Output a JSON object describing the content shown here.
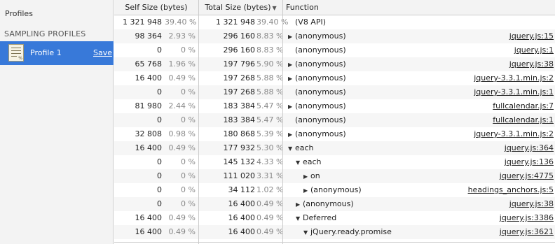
{
  "sidebar": {
    "title": "Profiles",
    "section": "SAMPLING PROFILES",
    "profile": {
      "label": "Profile 1",
      "save": "Save",
      "icon_text": "%"
    }
  },
  "columns": {
    "self": "Self Size (bytes)",
    "total": "Total Size (bytes)",
    "sort_indicator": "▼",
    "function": "Function"
  },
  "rows": [
    {
      "self": "1 321 948",
      "self_pct": "39.40 %",
      "total": "1 321 948",
      "total_pct": "39.40 %",
      "depth": 0,
      "arrow": "",
      "name": "(V8 API)",
      "src": ""
    },
    {
      "self": "98 364",
      "self_pct": "2.93 %",
      "total": "296 160",
      "total_pct": "8.83 %",
      "depth": 0,
      "arrow": "▶",
      "name": "(anonymous)",
      "src": "jquery.js:15"
    },
    {
      "self": "0",
      "self_pct": "0 %",
      "total": "296 160",
      "total_pct": "8.83 %",
      "depth": 0,
      "arrow": "",
      "name": "(anonymous)",
      "src": "jquery.js:1"
    },
    {
      "self": "65 768",
      "self_pct": "1.96 %",
      "total": "197 796",
      "total_pct": "5.90 %",
      "depth": 0,
      "arrow": "▶",
      "name": "(anonymous)",
      "src": "jquery.js:38"
    },
    {
      "self": "16 400",
      "self_pct": "0.49 %",
      "total": "197 268",
      "total_pct": "5.88 %",
      "depth": 0,
      "arrow": "▶",
      "name": "(anonymous)",
      "src": "jquery-3.3.1.min.js:2"
    },
    {
      "self": "0",
      "self_pct": "0 %",
      "total": "197 268",
      "total_pct": "5.88 %",
      "depth": 0,
      "arrow": "",
      "name": "(anonymous)",
      "src": "jquery-3.3.1.min.js:1"
    },
    {
      "self": "81 980",
      "self_pct": "2.44 %",
      "total": "183 384",
      "total_pct": "5.47 %",
      "depth": 0,
      "arrow": "▶",
      "name": "(anonymous)",
      "src": "fullcalendar.js:7"
    },
    {
      "self": "0",
      "self_pct": "0 %",
      "total": "183 384",
      "total_pct": "5.47 %",
      "depth": 0,
      "arrow": "",
      "name": "(anonymous)",
      "src": "fullcalendar.js:1"
    },
    {
      "self": "32 808",
      "self_pct": "0.98 %",
      "total": "180 868",
      "total_pct": "5.39 %",
      "depth": 0,
      "arrow": "▶",
      "name": "(anonymous)",
      "src": "jquery-3.3.1.min.js:2"
    },
    {
      "self": "16 400",
      "self_pct": "0.49 %",
      "total": "177 932",
      "total_pct": "5.30 %",
      "depth": 0,
      "arrow": "▼",
      "name": "each",
      "src": "jquery.js:364"
    },
    {
      "self": "0",
      "self_pct": "0 %",
      "total": "145 132",
      "total_pct": "4.33 %",
      "depth": 1,
      "arrow": "▼",
      "name": "each",
      "src": "jquery.js:136"
    },
    {
      "self": "0",
      "self_pct": "0 %",
      "total": "111 020",
      "total_pct": "3.31 %",
      "depth": 2,
      "arrow": "▶",
      "name": "on",
      "src": "jquery.js:4775"
    },
    {
      "self": "0",
      "self_pct": "0 %",
      "total": "34 112",
      "total_pct": "1.02 %",
      "depth": 2,
      "arrow": "▶",
      "name": "(anonymous)",
      "src": "headings_anchors.js:5"
    },
    {
      "self": "0",
      "self_pct": "0 %",
      "total": "16 400",
      "total_pct": "0.49 %",
      "depth": 1,
      "arrow": "▶",
      "name": "(anonymous)",
      "src": "jquery.js:38"
    },
    {
      "self": "16 400",
      "self_pct": "0.49 %",
      "total": "16 400",
      "total_pct": "0.49 %",
      "depth": 1,
      "arrow": "▼",
      "name": "Deferred",
      "src": "jquery.js:3386"
    },
    {
      "self": "16 400",
      "self_pct": "0.49 %",
      "total": "16 400",
      "total_pct": "0.49 %",
      "depth": 2,
      "arrow": "▼",
      "name": "jQuery.ready.promise",
      "src": "jquery.js:3621"
    }
  ]
}
